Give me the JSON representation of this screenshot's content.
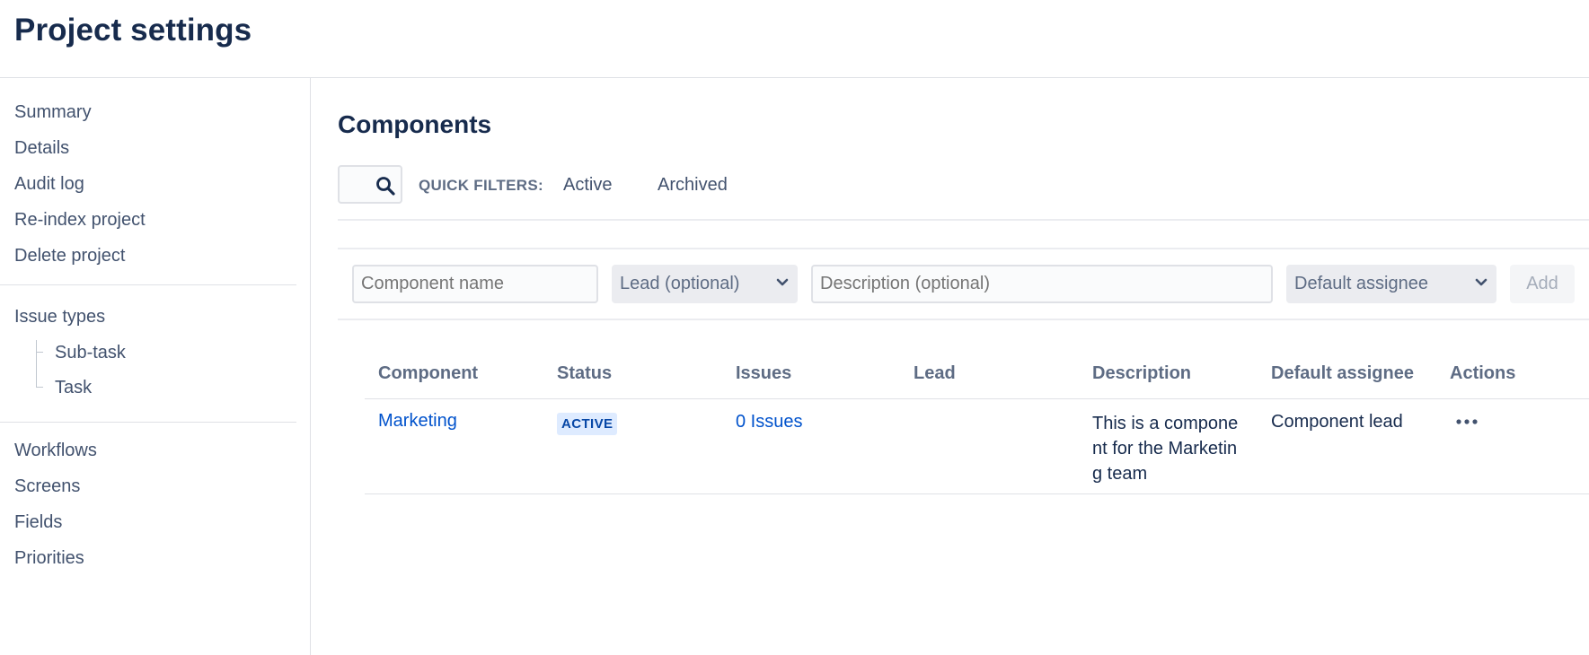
{
  "page": {
    "title": "Project settings"
  },
  "sidebar": {
    "group1": [
      "Summary",
      "Details",
      "Audit log",
      "Re-index project",
      "Delete project"
    ],
    "issue_types": {
      "label": "Issue types",
      "children": [
        "Sub-task",
        "Task"
      ]
    },
    "group3": [
      "Workflows",
      "Screens",
      "Fields",
      "Priorities"
    ]
  },
  "main": {
    "title": "Components",
    "search": {
      "icon": "search-icon"
    },
    "quick_filters": {
      "label": "QUICK FILTERS:",
      "items": [
        "Active",
        "Archived"
      ]
    },
    "form": {
      "name_placeholder": "Component name",
      "lead_select": "Lead (optional)",
      "description_placeholder": "Description (optional)",
      "assignee_select": "Default assignee",
      "add_label": "Add"
    },
    "table": {
      "headers": [
        "Component",
        "Status",
        "Issues",
        "Lead",
        "Description",
        "Default assignee",
        "Actions"
      ],
      "rows": [
        {
          "component": "Marketing",
          "status": "ACTIVE",
          "issues": "0 Issues",
          "lead": "",
          "description": "This is a component for the Marketing team",
          "default_assignee": "Component lead",
          "actions_icon": "more-icon"
        }
      ]
    }
  },
  "colors": {
    "link": "#0052cc",
    "lozenge_bg": "#deebff",
    "lozenge_text": "#0747a6",
    "heading": "#172b4d"
  }
}
